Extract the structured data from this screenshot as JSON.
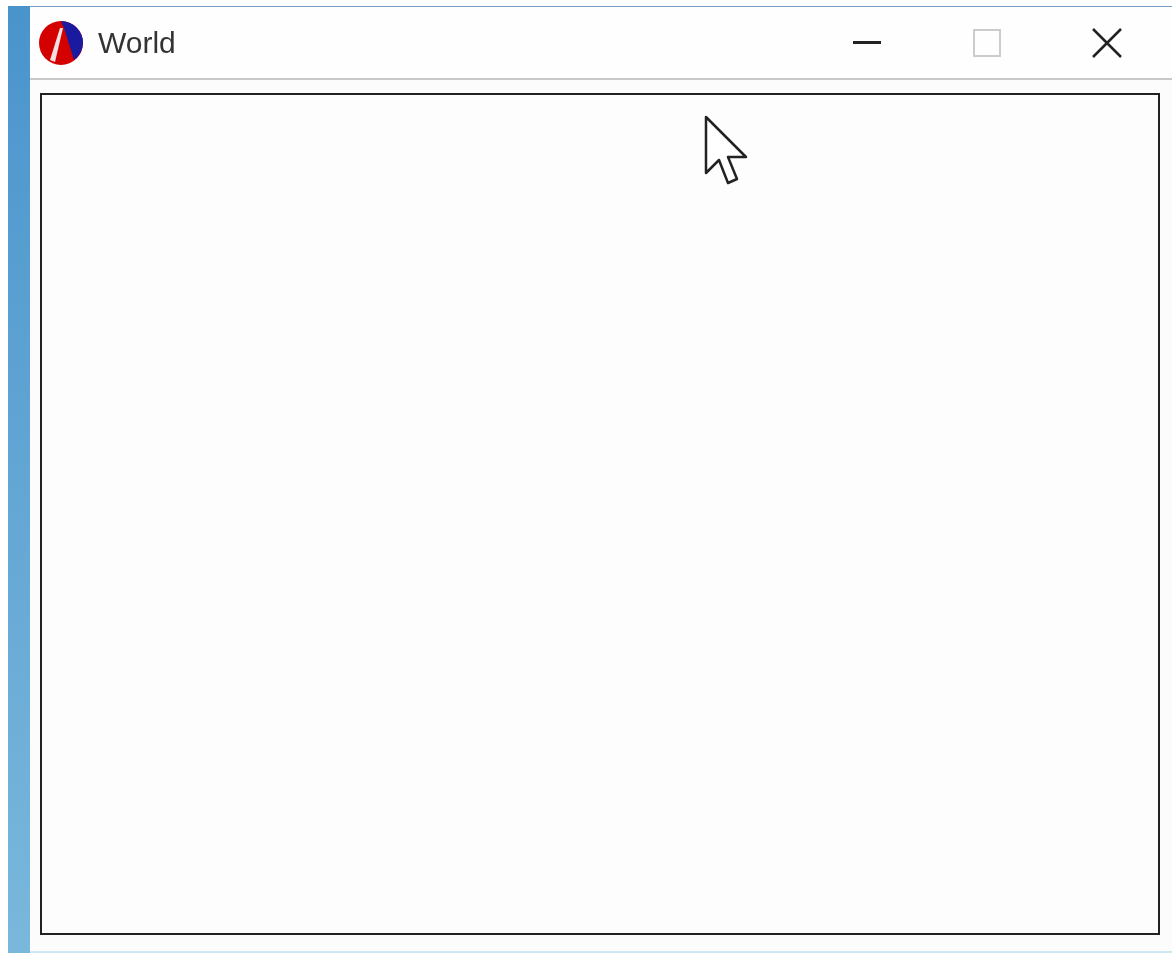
{
  "window": {
    "title": "World",
    "maximize": {
      "disabled": true
    }
  }
}
